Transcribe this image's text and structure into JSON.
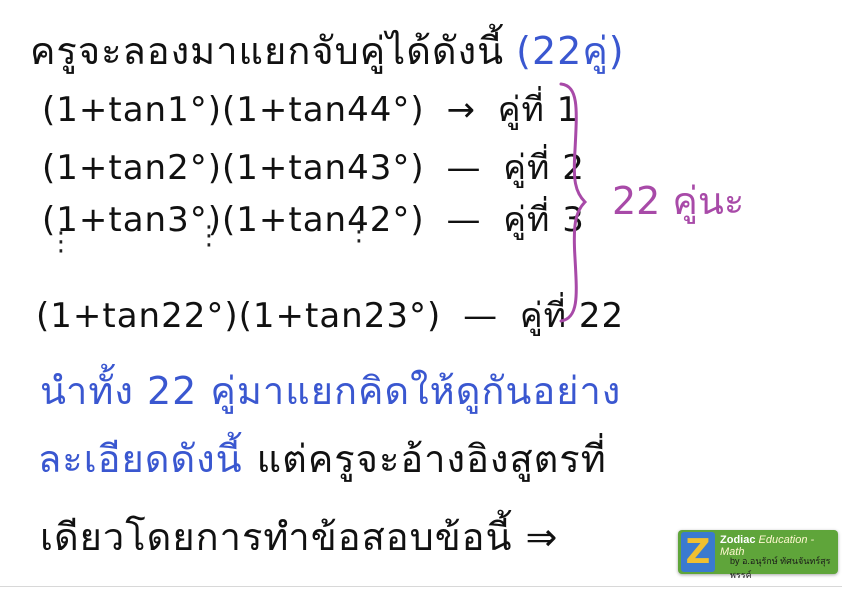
{
  "title": {
    "text": "ครูจะลองมาแยกจับคู่ได้ดังนี้",
    "count": "(22คู่)"
  },
  "pairs": [
    {
      "expr": "(1+tan1°)(1+tan44°)",
      "sep": "→",
      "label": "คู่ที่ 1"
    },
    {
      "expr": "(1+tan2°)(1+tan43°)",
      "sep": "—",
      "label": "คู่ที่ 2"
    },
    {
      "expr": "(1+tan3°)(1+tan42°)",
      "sep": "—",
      "label": "คู่ที่ 3"
    },
    {
      "expr": "(1+tan22°)(1+tan23°)",
      "sep": "—",
      "label": "คู่ที่ 22"
    }
  ],
  "vertical_dots": "⋮",
  "bracket_total": "22 คู่นะ",
  "blue_text": {
    "line1": "นำทั้ง 22 คู่มาแยกคิดให้ดูกันอย่าง",
    "line2": "ละเอียดดังนี้"
  },
  "line2_rest": "แต่ครูจะอ้างอิงสูตรที่",
  "line3": "เดียวโดยการทำข้อสอบข้อนี้ ⇒",
  "logo": {
    "letter": "Z",
    "brand": "Zodiac",
    "subtitle": "Education - Math",
    "byline": "by อ.อนุรักษ์ ทัศนจันทร์สุรพรรค์"
  },
  "colors": {
    "ink": "#111111",
    "bracket": "#a84aa8",
    "blue": "#3a57d0",
    "logo_green": "#5fa53a",
    "logo_blue": "#3a7ad0"
  }
}
